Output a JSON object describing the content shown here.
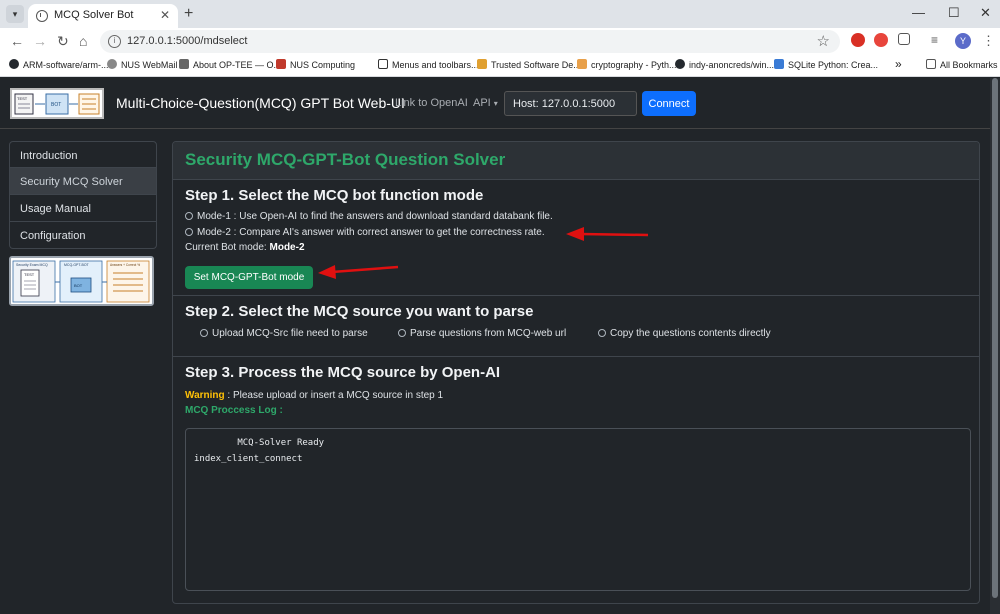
{
  "browser": {
    "tab_title": "MCQ Solver Bot",
    "url": "127.0.0.1:5000/mdselect",
    "avatar_letter": "Y",
    "bookmarks": [
      "ARM-software/arm-...",
      "NUS WebMail",
      "About OP-TEE — O...",
      "NUS Computing",
      "Menus and toolbars...",
      "Trusted Software De...",
      "cryptography - Pyth...",
      "indy-anoncreds/win...",
      "SQLite Python: Crea..."
    ],
    "all_bookmarks": "All Bookmarks"
  },
  "navbar": {
    "title": "Multi-Choice-Question(MCQ) GPT Bot Web-UI",
    "link_openai": "Link to OpenAI",
    "api_label": "API",
    "host_value": "Host: 127.0.0.1:5000",
    "connect_label": "Connect"
  },
  "sidebar": {
    "items": [
      {
        "label": "Introduction"
      },
      {
        "label": "Security MCQ Solver"
      },
      {
        "label": "Usage Manual"
      },
      {
        "label": "Configuration"
      }
    ],
    "image_labels": [
      "Security Exam MCQ",
      "MCQ-GPT-BOT",
      "Answers + Correct %",
      "TEST",
      "BOT"
    ]
  },
  "logo_labels": [
    "TEST",
    "BOT"
  ],
  "main": {
    "title": "Security MCQ-GPT-Bot Question Solver",
    "step1": {
      "heading": "Step 1. Select the MCQ bot function mode",
      "mode1": "Mode-1 : Use Open-AI to find the answers and download standard databank file.",
      "mode2": "Mode-2 : Compare AI's answer with correct answer to get the correctness rate.",
      "current_label": "Current Bot mode:",
      "current_value": "Mode-2",
      "button": "Set MCQ-GPT-Bot mode"
    },
    "step2": {
      "heading": "Step 2. Select the MCQ source you want to parse",
      "option1": "Upload MCQ-Src file need to parse",
      "option2": "Parse questions from MCQ-web url",
      "option3": "Copy the questions contents directly"
    },
    "step3": {
      "heading": "Step 3. Process the MCQ source by Open-AI",
      "warning_label": "Warning",
      "warning_text": " : Please upload or insert a MCQ source in step 1",
      "log_label": "MCQ Proccess Log :",
      "log_line1": "        MCQ-Solver Ready",
      "log_line2": "index_client_connect"
    }
  },
  "colors": {
    "accent_green": "#2ea86a",
    "button_green": "#198754",
    "connect_blue": "#0d6efd",
    "warning_yellow": "#ffc107",
    "annotation_red": "#e01010"
  }
}
